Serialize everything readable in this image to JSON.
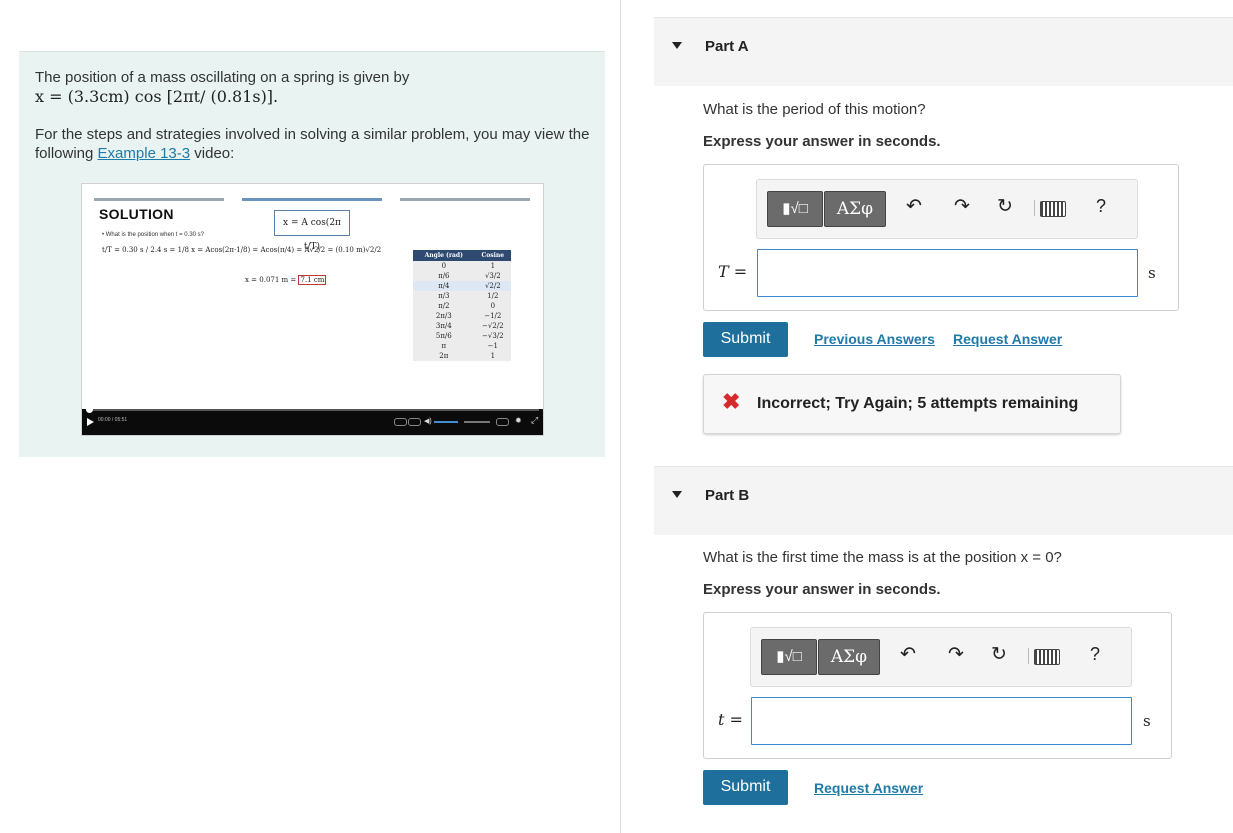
{
  "problem": {
    "intro": "The position of a mass oscillating on a spring is given by",
    "equation": "x = (3.3cm) cos [2πt/ (0.81s)].",
    "strategy_pre": "For the steps and strategies involved in solving a similar problem, you may view the following",
    "link_text": "Example 13-3",
    "strategy_post": "video:"
  },
  "video": {
    "solution_heading": "SOLUTION",
    "formula": "x = A cos(2π t/T)",
    "question": "• What is the position when t = 0.30 s?",
    "calc": "t/T = 0.30 s / 2.4 s = 1/8    x = Acos(2π·1/8) = Acos(π/4) = A√2/2 = (0.10 m)√2/2",
    "result_prefix": "x = 0.071 m = ",
    "result_boxed": "7.1 cm",
    "table_headers": [
      "Angle (rad)",
      "Cosine"
    ],
    "table_rows": [
      [
        "0",
        "1"
      ],
      [
        "π/6",
        "√3/2"
      ],
      [
        "π/4",
        "√2/2"
      ],
      [
        "π/3",
        "1/2"
      ],
      [
        "π/2",
        "0"
      ],
      [
        "2π/3",
        "−1/2"
      ],
      [
        "3π/4",
        "−√2/2"
      ],
      [
        "5π/6",
        "−√3/2"
      ],
      [
        "π",
        "−1"
      ],
      [
        "2π",
        "1"
      ]
    ],
    "time": "00:00 / 05:51"
  },
  "part_a": {
    "title": "Part A",
    "question": "What is the period of this motion?",
    "instruction": "Express your answer in seconds.",
    "variable": "T =",
    "unit": "s",
    "input_value": "",
    "submit_label": "Submit",
    "previous_answers": "Previous Answers",
    "request_answer": "Request Answer",
    "feedback": "Incorrect; Try Again; 5 attempts remaining"
  },
  "part_b": {
    "title": "Part B",
    "question": "What is the first time the mass is at the position x = 0?",
    "instruction": "Express your answer in seconds.",
    "variable": "t =",
    "unit": "s",
    "input_value": "",
    "submit_label": "Submit",
    "request_answer": "Request Answer"
  },
  "toolbar": {
    "matrix_label": "▮√□",
    "greek_label": "ΑΣφ",
    "undo_icon": "↶",
    "redo_icon": "↷",
    "reset_icon": "↻",
    "help_label": "?"
  },
  "colors": {
    "accent": "#1f6f9c",
    "link": "#1f7aa8",
    "error": "#d62b2b",
    "panel_bg": "#e8f3f2"
  }
}
